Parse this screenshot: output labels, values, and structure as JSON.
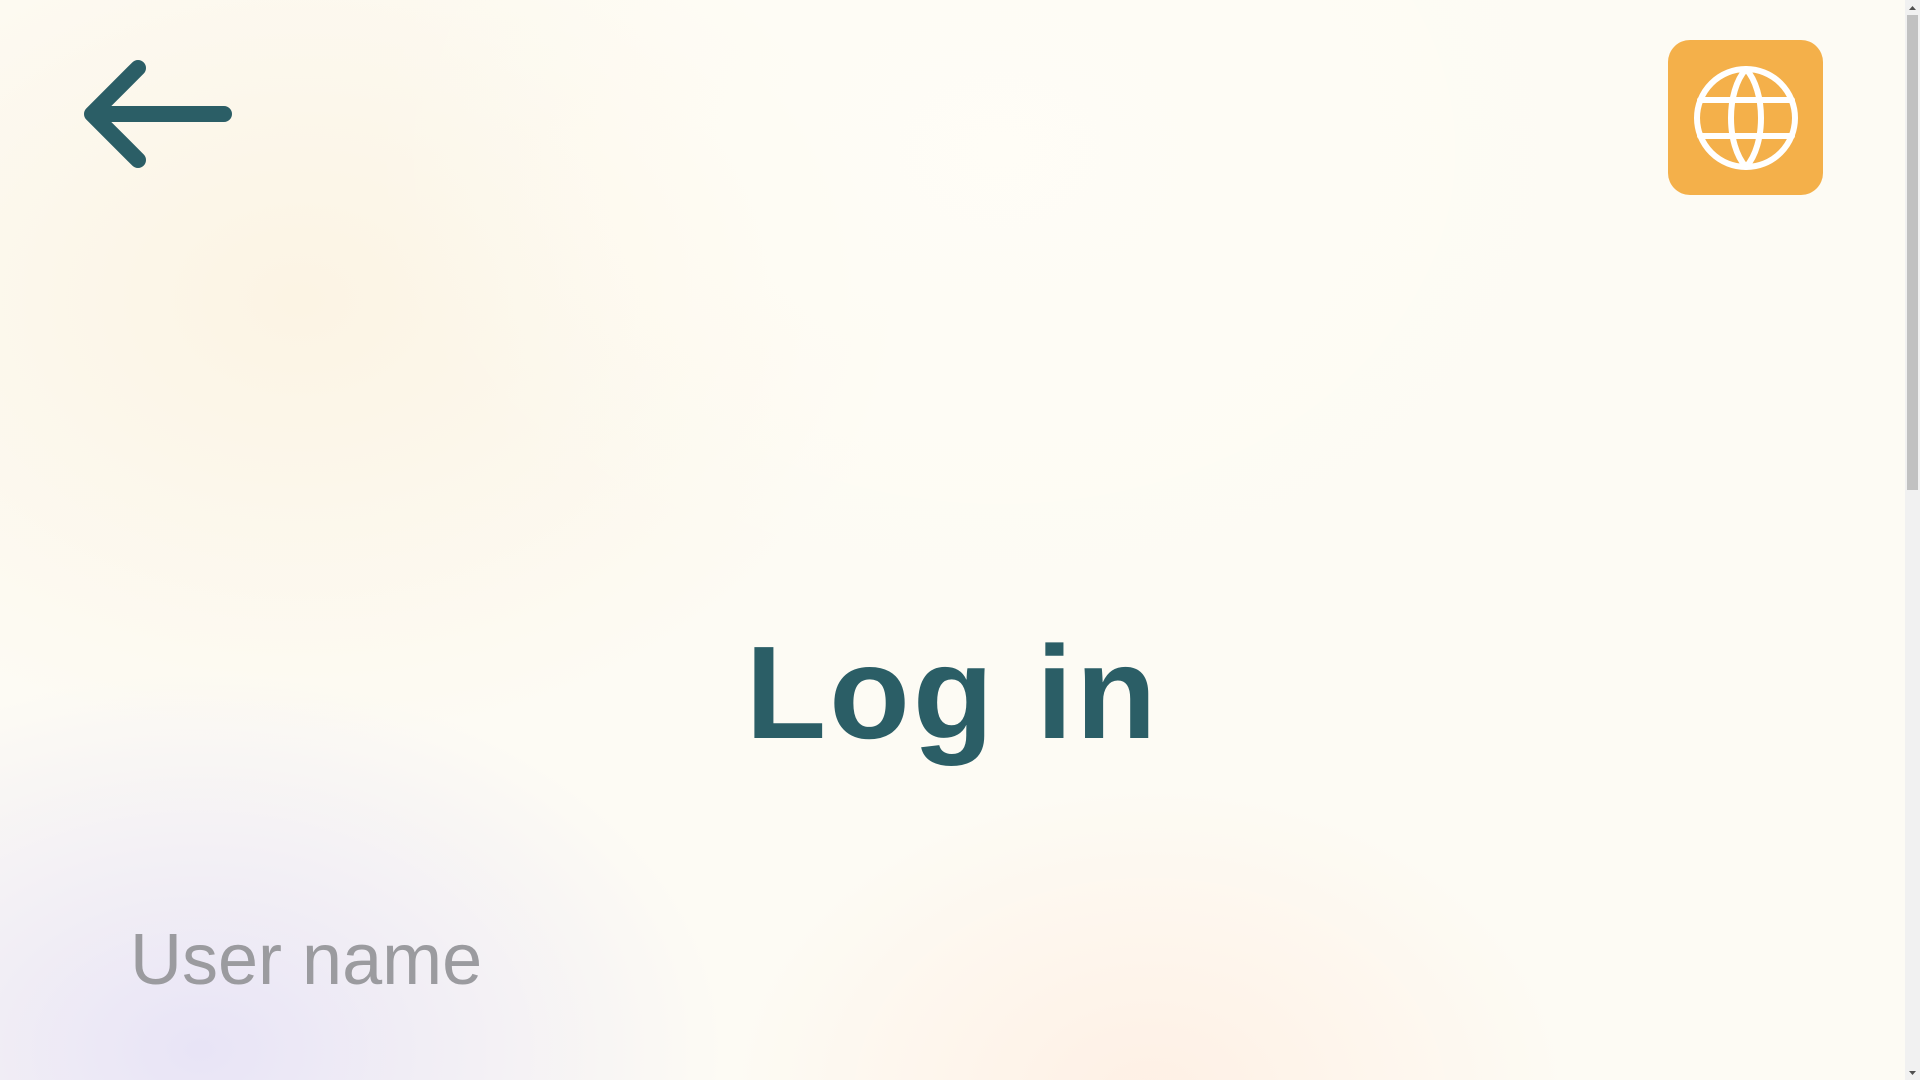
{
  "page": {
    "title": "Log in"
  },
  "form": {
    "username_placeholder": "User name",
    "username_value": ""
  },
  "icons": {
    "back": "arrow-left-icon",
    "language": "globe-icon"
  },
  "colors": {
    "primary": "#2b5e66",
    "accent": "#f4b04a",
    "placeholder": "#9b9b9f",
    "background": "#fdfbf4"
  }
}
